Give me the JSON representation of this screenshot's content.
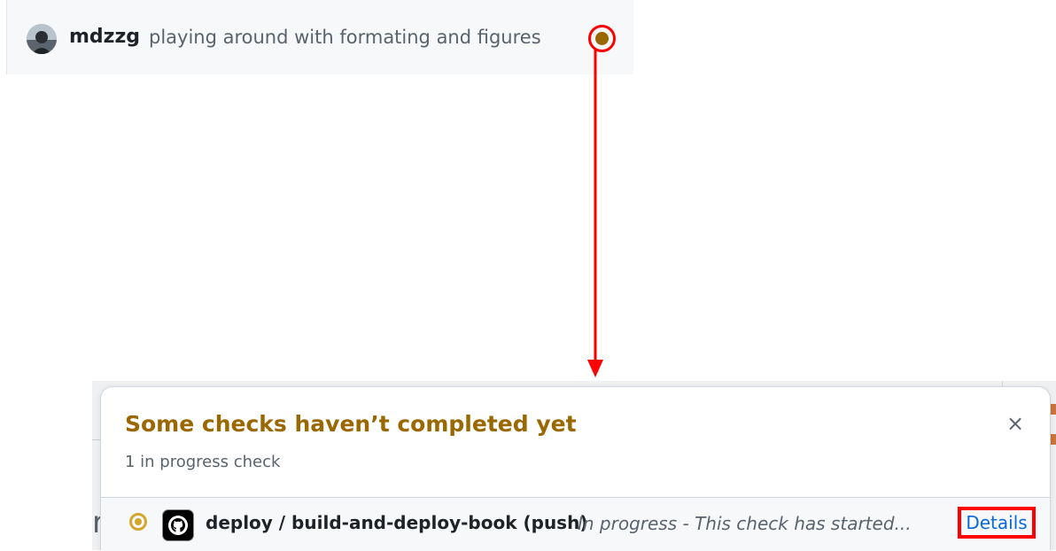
{
  "commit": {
    "author": "mdzzg",
    "message": "playing around with formating and figures",
    "status": "in-progress"
  },
  "popover": {
    "title": "Some checks haven’t completed yet",
    "subtitle": "1 in progress check",
    "close_icon": "×",
    "checks": [
      {
        "name": "deploy / build-and-deploy-book (push)",
        "description": "In progress - This check has started...",
        "link_label": "Details",
        "status": "in-progress",
        "app_icon": "github-icon"
      }
    ]
  },
  "backdrop": {
    "partial_glyph": "r"
  },
  "colors": {
    "pending": "#9a6700",
    "pending_icon": "#d4a72c",
    "annotation": "#ff0000",
    "link": "#0969da"
  }
}
